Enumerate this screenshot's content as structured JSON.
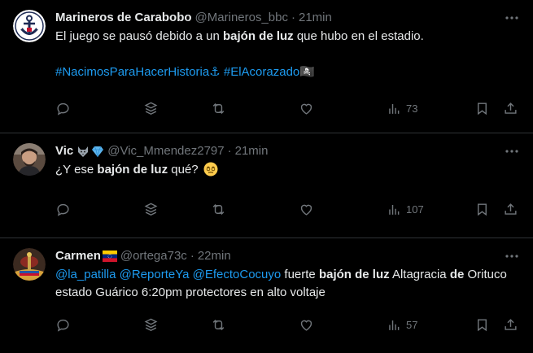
{
  "tweets": [
    {
      "name": "Marineros de Carabobo",
      "handle": "@Marineros_bbc",
      "time": "21min",
      "text_pre": "El juego se pausó debido a un ",
      "text_bold": "bajón de luz",
      "text_post": " que hubo en el estadio.",
      "hashtag1": "#NacimosParaHacerHistoria⚓",
      "hashtag2": "#ElAcorazado🏴‍☠️",
      "views": "73"
    },
    {
      "name": "Vic",
      "handle": "@Vic_Mmendez2797",
      "time": "21min",
      "text_pre": "¿Y ese ",
      "text_bold": "bajón de luz",
      "text_post": " qué?",
      "views": "107"
    },
    {
      "name": "Carmen",
      "handle": "@ortega73c",
      "time": "22min",
      "mention1": "@la_patilla",
      "mention2": "@ReporteYa",
      "mention3": "@EfectoCocuyo",
      "text_a": " fuerte ",
      "text_bold1": "bajón de luz",
      "text_b": " Altagracia ",
      "text_bold2": "de",
      "text_c": " Orituco estado Guárico 6:20pm protectores en alto voltaje",
      "views": "57"
    }
  ],
  "separator": "·",
  "icons": [
    "reply-icon",
    "grok-icon",
    "retweet-icon",
    "like-icon",
    "views-icon",
    "bookmark-icon",
    "share-icon",
    "more-icon"
  ],
  "colors": {
    "background": "#000000",
    "text": "#e7e9ea",
    "muted": "#71767b",
    "link": "#1d9bf0",
    "border": "#2f3336"
  }
}
